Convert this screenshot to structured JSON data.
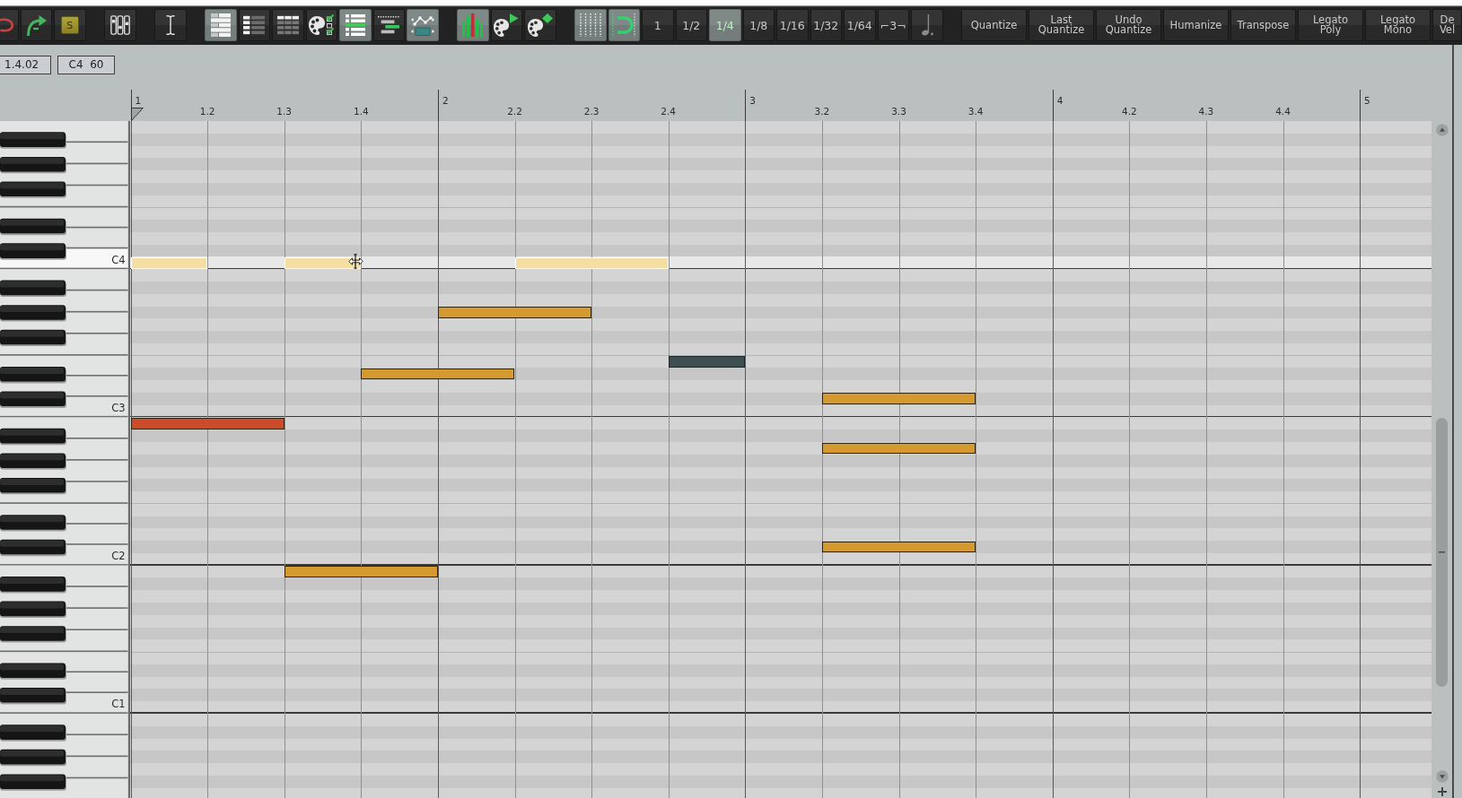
{
  "toolbar": {
    "groups": [
      {
        "buttons": [
          {
            "kind": "icon",
            "on": false
          },
          {
            "kind": "icon",
            "on": false
          },
          {
            "kind": "solo",
            "label": "S"
          }
        ]
      },
      {
        "buttons": [
          {
            "kind": "icon",
            "on": false
          }
        ]
      },
      {
        "buttons": [
          {
            "kind": "icon",
            "on": false
          }
        ]
      },
      {
        "buttons": [
          {
            "kind": "icon",
            "on": true
          },
          {
            "kind": "icon",
            "on": false
          },
          {
            "kind": "icon",
            "on": false
          },
          {
            "kind": "icon",
            "on": false
          },
          {
            "kind": "icon",
            "on": true
          },
          {
            "kind": "icon",
            "on": false
          },
          {
            "kind": "icon",
            "on": true
          }
        ]
      },
      {
        "buttons": [
          {
            "kind": "icon",
            "on": true
          },
          {
            "kind": "icon",
            "on": false
          },
          {
            "kind": "icon",
            "on": false
          }
        ]
      },
      {
        "buttons": [
          {
            "kind": "icon",
            "on": true
          },
          {
            "kind": "icon",
            "on": true
          },
          {
            "kind": "division",
            "label": "1",
            "selected": false
          },
          {
            "kind": "division",
            "label": "1/2",
            "selected": false
          },
          {
            "kind": "division",
            "label": "1/4",
            "selected": true
          },
          {
            "kind": "division",
            "label": "1/8",
            "selected": false
          },
          {
            "kind": "division",
            "label": "1/16",
            "selected": false
          },
          {
            "kind": "division",
            "label": "1/32",
            "selected": false
          },
          {
            "kind": "division",
            "label": "1/64",
            "selected": false
          },
          {
            "kind": "toggle",
            "label": "⌐3¬",
            "on": false
          },
          {
            "kind": "icon",
            "on": false
          }
        ]
      },
      {
        "buttons": [
          {
            "kind": "action",
            "label": "Quantize"
          },
          {
            "kind": "action",
            "label": "Last Quantize"
          },
          {
            "kind": "action",
            "label": "Undo Quantize"
          },
          {
            "kind": "action",
            "label": "Humanize"
          },
          {
            "kind": "action",
            "label": "Transpose"
          },
          {
            "kind": "action",
            "label": "Legato Poly"
          },
          {
            "kind": "action",
            "label": "Legato Mono"
          },
          {
            "kind": "action",
            "label": "De Vel"
          }
        ]
      }
    ]
  },
  "info_fields": [
    {
      "value": "1.4.02"
    },
    {
      "value": "C4  60"
    }
  ],
  "ruler": {
    "marks": [
      {
        "kind": "bar",
        "label": "1"
      },
      {
        "kind": "beat",
        "label": "1.2"
      },
      {
        "kind": "beat",
        "label": "1.3"
      },
      {
        "kind": "beat",
        "label": "1.4"
      },
      {
        "kind": "bar",
        "label": "2"
      },
      {
        "kind": "beat",
        "label": "2.2"
      },
      {
        "kind": "beat",
        "label": "2.3"
      },
      {
        "kind": "beat",
        "label": "2.4"
      },
      {
        "kind": "bar",
        "label": "3"
      },
      {
        "kind": "beat",
        "label": "3.2"
      },
      {
        "kind": "beat",
        "label": "3.3"
      },
      {
        "kind": "beat",
        "label": "3.4"
      },
      {
        "kind": "bar",
        "label": "4"
      },
      {
        "kind": "beat",
        "label": "4.2"
      },
      {
        "kind": "beat",
        "label": "4.3"
      },
      {
        "kind": "beat",
        "label": "4.4"
      },
      {
        "kind": "bar",
        "label": "5"
      }
    ]
  },
  "keyboard": {
    "c_keys": [
      {
        "label": "C4",
        "highlighted": true
      },
      {
        "label": "C3",
        "highlighted": false
      },
      {
        "label": "C2",
        "highlighted": false
      },
      {
        "label": "C1",
        "highlighted": false
      }
    ]
  },
  "notes": [
    {
      "kind": "ghost",
      "color": "#f5dea4"
    },
    {
      "kind": "ghost",
      "color": "#f5dea4"
    },
    {
      "kind": "ghost",
      "color": "#f5dea4"
    },
    {
      "kind": "note",
      "color": "#d49a2f"
    },
    {
      "kind": "note",
      "color": "#3e4f51"
    },
    {
      "kind": "note",
      "color": "#d49a2f"
    },
    {
      "kind": "note",
      "color": "#d49a2f"
    },
    {
      "kind": "note",
      "color": "#cc4b2d"
    },
    {
      "kind": "note",
      "color": "#d49a2f"
    },
    {
      "kind": "note",
      "color": "#d49a2f"
    },
    {
      "kind": "note",
      "color": "#d49a2f"
    }
  ]
}
